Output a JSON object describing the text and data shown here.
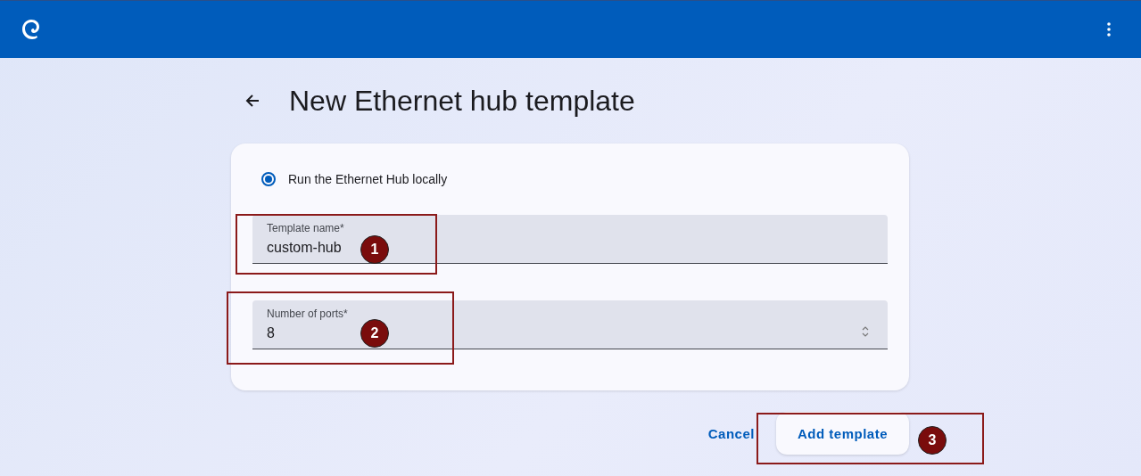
{
  "page_title": "New Ethernet hub template",
  "option": {
    "label": "Run the Ethernet Hub locally",
    "selected": true
  },
  "fields": [
    {
      "kind": "text",
      "label": "Template name*",
      "value": "custom-hub"
    },
    {
      "kind": "number",
      "label": "Number of ports*",
      "value": "8"
    }
  ],
  "actions": {
    "cancel": "Cancel",
    "submit": "Add template"
  },
  "annotations": [
    {
      "number": "1"
    },
    {
      "number": "2"
    },
    {
      "number": "3"
    }
  ]
}
